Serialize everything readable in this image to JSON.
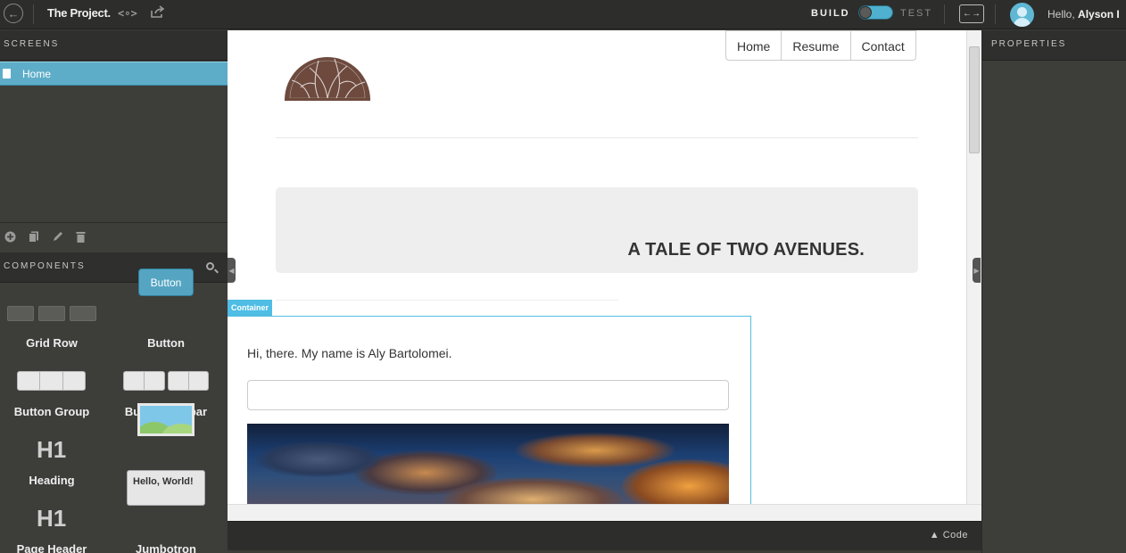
{
  "app": {
    "project_title": "The Project.",
    "code_icon_text": "<∘>",
    "build_label": "BUILD",
    "test_label": "TEST",
    "hello_prefix": "Hello,",
    "user_name": "Alyson I",
    "accent_color": "#5eadc8"
  },
  "screens": {
    "header": "SCREENS",
    "items": [
      {
        "label": "Home",
        "selected": true
      }
    ],
    "tool_icons": [
      "add-icon",
      "duplicate-icon",
      "edit-icon",
      "delete-icon"
    ]
  },
  "components": {
    "header": "COMPONENTS",
    "items": [
      {
        "label": "Grid Row",
        "icon": "grid-row-icon"
      },
      {
        "label": "Button",
        "icon": "button-preview",
        "preview_text": "Button"
      },
      {
        "label": "Button Group",
        "icon": "button-group-icon"
      },
      {
        "label": "Button Toolbar",
        "icon": "button-toolbar-icon"
      },
      {
        "label": "Heading",
        "icon": "h1-icon",
        "preview_text": "H1"
      },
      {
        "label": "Image",
        "icon": "image-icon"
      },
      {
        "label": "Page Header",
        "icon": "h1-icon",
        "preview_text": "H1"
      },
      {
        "label": "Jumbotron",
        "icon": "jumbotron-icon",
        "preview_text": "Hello, World!"
      }
    ]
  },
  "canvas": {
    "nav": [
      "Home",
      "Resume",
      "Contact"
    ],
    "jumbotron_title": "A TALE OF TWO AVENUES.",
    "container_tag": "Container",
    "greeting": "Hi, there. My name is Aly Bartolomei.",
    "input_value": ""
  },
  "properties": {
    "header": "PROPERTIES"
  },
  "footer": {
    "code_label": "Code"
  }
}
